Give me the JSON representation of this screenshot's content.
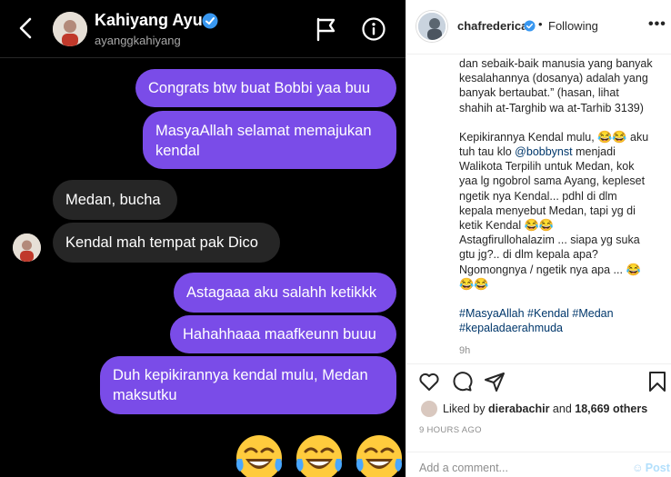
{
  "dm": {
    "name": "Kahiyang Ayu",
    "handle": "ayanggkahiyang",
    "messages": [
      {
        "text": "Congrats btw buat Bobbi yaa buu",
        "side": "out"
      },
      {
        "text": "MasyaAllah selamat memajukan kendal",
        "side": "out"
      },
      {
        "text": "Medan, bucha",
        "side": "in"
      },
      {
        "text": "Kendal mah tempat pak Dico",
        "side": "in"
      },
      {
        "text": "Astagaaa aku salahh ketikkk",
        "side": "out"
      },
      {
        "text": "Hahahhaaa maafkeunn buuu",
        "side": "out"
      },
      {
        "text": "Duh kepikirannya kendal mulu, Medan maksutku",
        "side": "out"
      }
    ],
    "emojis": [
      "😂",
      "😂",
      "😂"
    ],
    "colors": {
      "outgoing": "#7a4ce8",
      "incoming": "#262626",
      "background": "#000000"
    }
  },
  "post": {
    "username": "chafrederica",
    "follow_status": "Following",
    "more": "•••",
    "caption": {
      "p1_l1": "dan sebaik-baik manusia yang banyak",
      "p1_l2": "kesalahannya (dosanya) adalah yang",
      "p1_l3": "banyak bertaubat.” (hasan, lihat",
      "p1_l4": "shahih at-Targhib wa at-Tarhib 3139)",
      "p2_a": "Kepikirannya Kendal mulu,",
      "p2_emoji1": "😂😂",
      "p2_b": "aku",
      "p2_c": "tuh tau klo",
      "mention": "@bobbynst",
      "p2_d": "menjadi",
      "p2_l3": "Walikota Terpilih untuk Medan, kok",
      "p2_l4": "yaa lg ngobrol sama Ayang, kepleset",
      "p2_l5": "ngetik nya Kendal... pdhl di dlm",
      "p2_l6": "kepala menyebut Medan, tapi yg di",
      "p2_l7": "ketik Kendal",
      "p2_emoji2": "😂😂",
      "p2_l8": "Astagfirullohalazim ... siapa yg suka",
      "p2_l9": "gtu jg?.. di dlm kepala apa?",
      "p2_l10": "Ngomongnya / ngetik nya apa ...",
      "p2_emoji3": "😂",
      "p2_emoji4": "😂😂",
      "tags_l1": "#MasyaAllah #Kendal #Medan",
      "tags_l2": "#kepaladaerahmuda"
    },
    "time_ago": "9h",
    "liked_by_prefix": "Liked by",
    "liked_by_user": "dierabachir",
    "liked_by_suffix": "and",
    "likes_count": "18,669 others",
    "posted": "9 HOURS AGO",
    "comment_placeholder": "Add a comment...",
    "post_button": "Post"
  }
}
